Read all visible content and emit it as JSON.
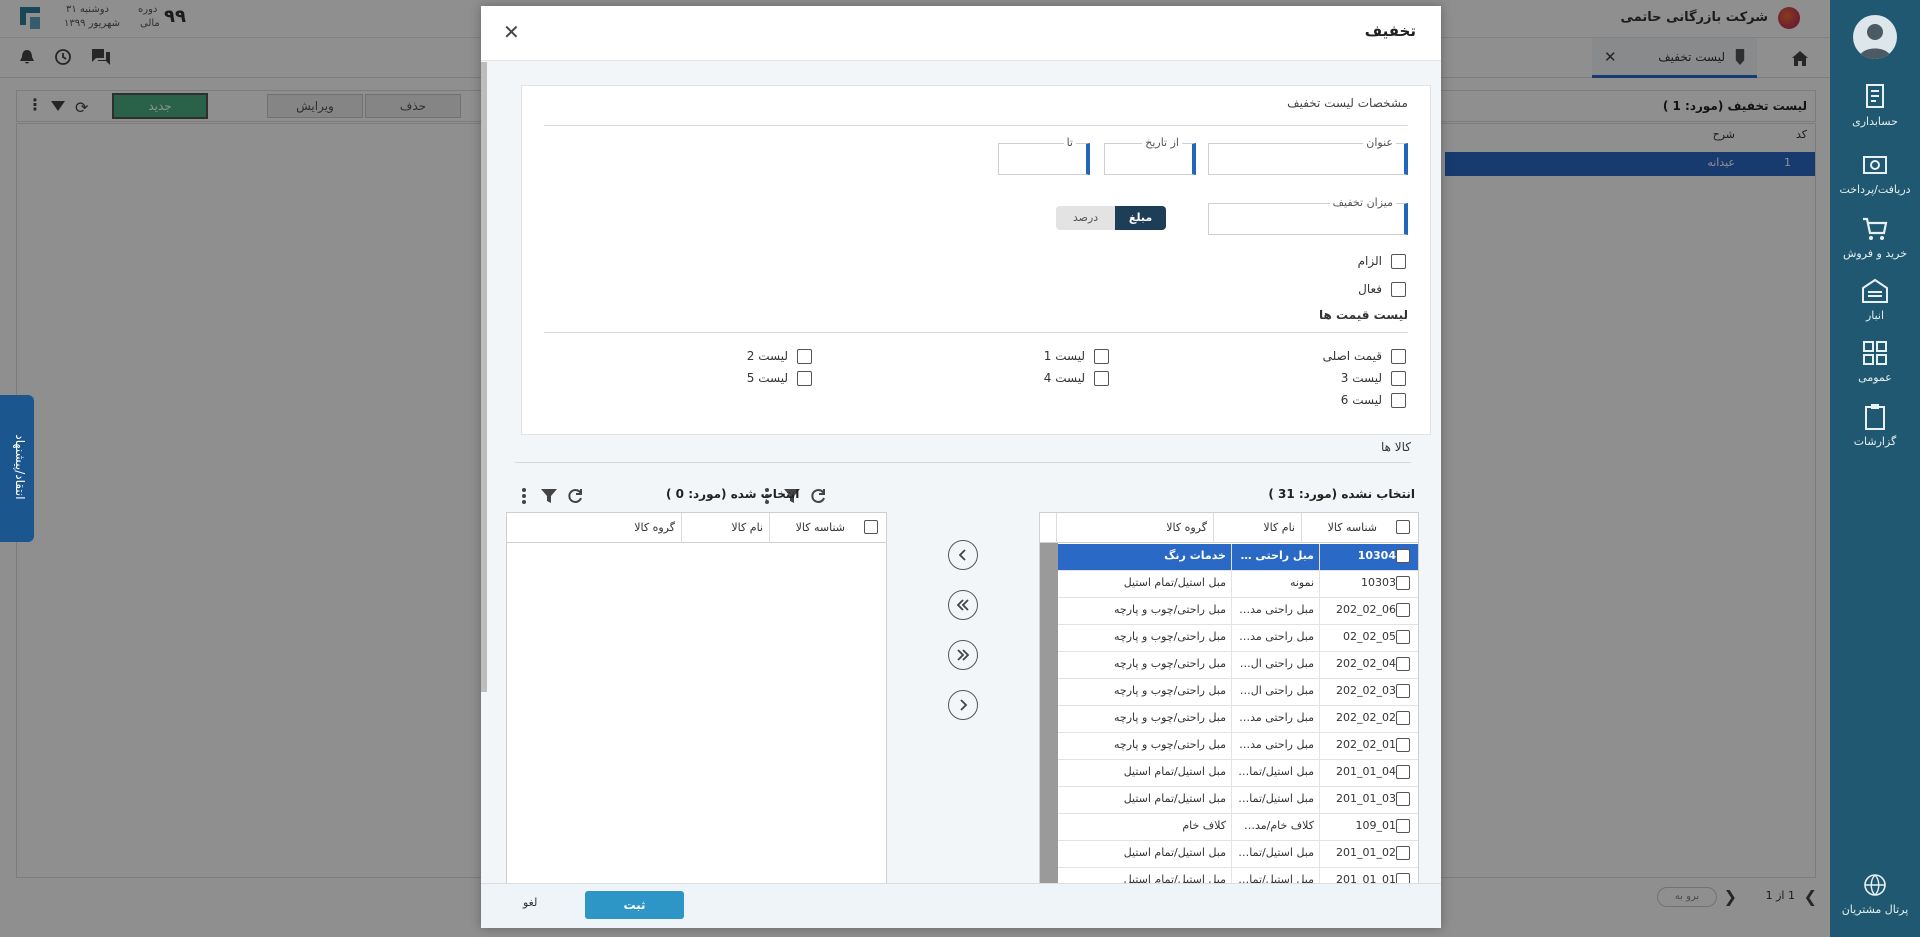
{
  "header": {
    "company": "شرکت بازرگانی حاتمی",
    "period_label": "دوره",
    "period_sub": "مالی",
    "period_value": "۹۹",
    "day": "دوشنبه ۳۱",
    "month": "شهریور ۱۳۹۹"
  },
  "tabs": {
    "active": "لیست تخفیف"
  },
  "sidebar": {
    "items": [
      {
        "label": "حسابداری",
        "icon": "accounting-icon"
      },
      {
        "label": "دریافت/پرداخت",
        "icon": "cash-icon"
      },
      {
        "label": "خرید و فروش",
        "icon": "cart-icon"
      },
      {
        "label": "انبار",
        "icon": "warehouse-icon"
      },
      {
        "label": "عمومی",
        "icon": "general-icon"
      },
      {
        "label": "گزارشات",
        "icon": "reports-icon"
      }
    ],
    "portal": "پرتال مشتریان"
  },
  "list": {
    "title": "لیست تخفیف (مورد:  1 )",
    "new": "جدید",
    "edit": "ویرایش",
    "delete": "حذف",
    "col_code": "کد",
    "col_desc": "شرح",
    "row_code": "1",
    "row_desc": "عیدانه",
    "pager_text": "1  از  1",
    "goto": "برو به"
  },
  "feedback": "انتقاد/پیشنهاد",
  "modal": {
    "title": "تخفیف",
    "section": "مشخصات لیست تخفیف",
    "fields": {
      "title_label": "عنوان",
      "from_label": "از تاریخ",
      "to_label": "تا",
      "amount_label": "میزان تخفیف"
    },
    "toggle": {
      "amount": "مبلغ",
      "percent": "درصد"
    },
    "checks": {
      "required": "الزام",
      "active": "فعال"
    },
    "price_lists_title": "لیست قیمت ها",
    "price_lists": [
      "قیمت اصلی",
      "لیست 1",
      "لیست 2",
      "لیست 3",
      "لیست 4",
      "لیست 5",
      "لیست 6"
    ],
    "goods_title": "کالا ها",
    "unselected": {
      "title": "انتخاب نشده (مورد:  31 )",
      "col_id": "شناسه کالا",
      "col_name": "نام کالا",
      "col_group": "گروه کالا",
      "rows": [
        {
          "id": "10304",
          "name": "مبل راحتی مدل ...",
          "group": "خدمات رنگ",
          "selected": true
        },
        {
          "id": "10303",
          "name": "نمونه",
          "group": "مبل استیل/تمام استیل"
        },
        {
          "id": "06_02_202",
          "name": "مبل راحتی مدل ...",
          "group": "مبل راحتی/چوب و پارچه"
        },
        {
          "id": "05_02_02",
          "name": "مبل راحتی مدل ...",
          "group": "مبل راحتی/چوب و پارچه"
        },
        {
          "id": "04_02_202",
          "name": "مبل راحتی ال مد...",
          "group": "مبل راحتی/چوب و پارچه"
        },
        {
          "id": "03_02_202",
          "name": "مبل راحتی ال مد...",
          "group": "مبل راحتی/چوب و پارچه"
        },
        {
          "id": "02_02_202",
          "name": "مبل راحتی مدل ا...",
          "group": "مبل راحتی/چوب و پارچه"
        },
        {
          "id": "01_02_202",
          "name": "مبل راحتی مدل ...",
          "group": "مبل راحتی/چوب و پارچه"
        },
        {
          "id": "04_01_201",
          "name": "مبل استیل/تمام ...",
          "group": "مبل استیل/تمام استیل"
        },
        {
          "id": "03_01_201",
          "name": "مبل استیل/تمام ...",
          "group": "مبل استیل/تمام استیل"
        },
        {
          "id": "01_109",
          "name": "کلاف خام/مدل پ...",
          "group": "کلاف خام"
        },
        {
          "id": "02_01_201",
          "name": "مبل استیل/تمام ...",
          "group": "مبل استیل/تمام استیل"
        },
        {
          "id": "01_01_201",
          "name": "مبل استیل/تمام ...",
          "group": "مبل استیل/تمام استیل"
        }
      ]
    },
    "selected_grid": {
      "title": "انتخاب شده (مورد:  0 )",
      "col_id": "شناسه کالا",
      "col_name": "نام کالا",
      "col_group": "گروه کالا"
    },
    "buttons": {
      "save": "ثبت",
      "cancel": "لغو"
    }
  },
  "colors": {
    "sidebar": "#1f5870",
    "accent": "#2a6ac6",
    "save": "#2e96c7"
  }
}
